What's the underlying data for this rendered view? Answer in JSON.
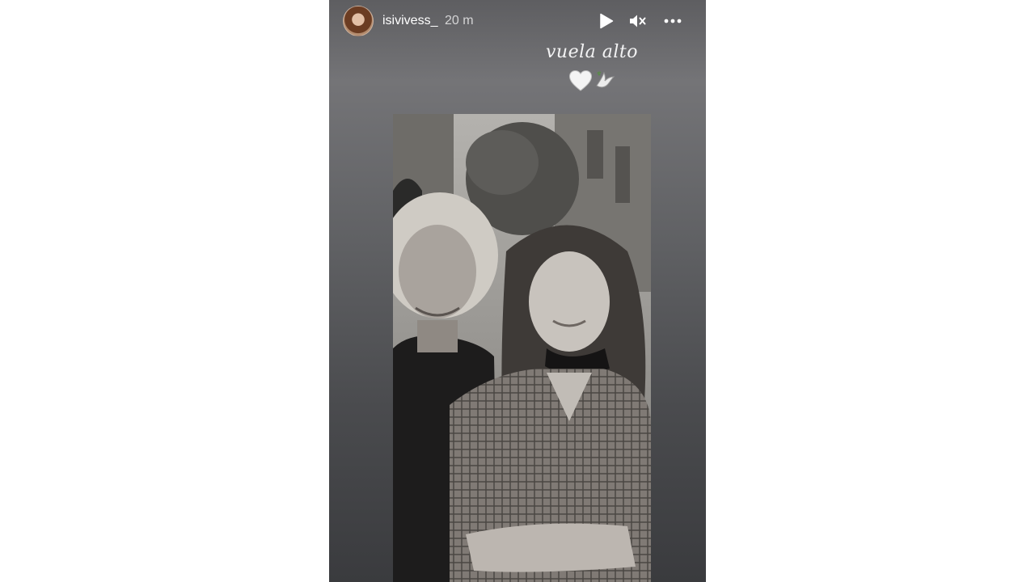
{
  "story": {
    "username": "isivivess_",
    "timestamp": "20 m",
    "caption": "vuela alto",
    "emojis": [
      "white-heart",
      "dove"
    ]
  },
  "controls": {
    "play_icon": "play-icon",
    "mute_icon": "muted-speaker-icon",
    "more_icon": "more-options-icon"
  },
  "colors": {
    "story_background_top": "#5e5e61",
    "story_background_bottom": "#3a3b3e",
    "text": "#ffffff"
  }
}
